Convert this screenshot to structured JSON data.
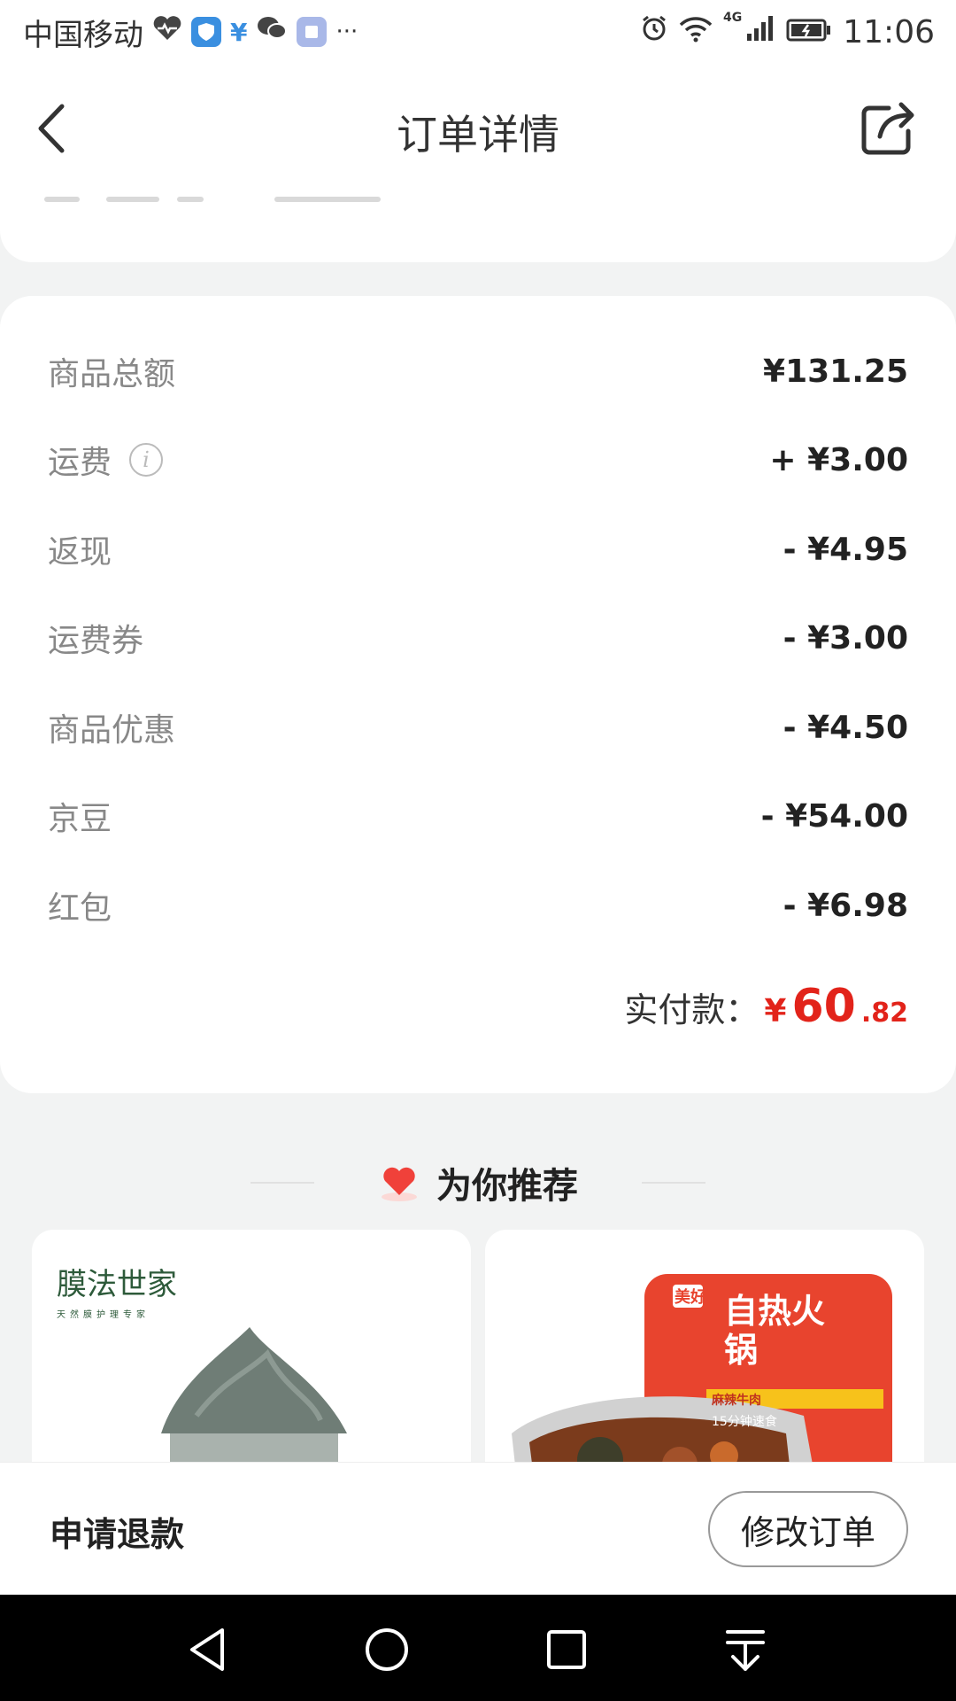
{
  "status_bar": {
    "carrier": "中国移动",
    "network": "4G",
    "time": "11:06",
    "overflow": "···"
  },
  "nav": {
    "title": "订单详情"
  },
  "price_rows": [
    {
      "label": "商品总额",
      "value": "¥131.25"
    },
    {
      "label": "运费",
      "value": "+ ¥3.00"
    },
    {
      "label": "返现",
      "value": "- ¥4.95"
    },
    {
      "label": "运费券",
      "value": "- ¥3.00"
    },
    {
      "label": "商品优惠",
      "value": "- ¥4.50"
    },
    {
      "label": "京豆",
      "value": "- ¥54.00"
    },
    {
      "label": "红包",
      "value": "- ¥6.98"
    }
  ],
  "total": {
    "label": "实付款：",
    "currency": "¥",
    "integer": "60",
    "decimal": ".82"
  },
  "recommend": {
    "title": "为你推荐"
  },
  "products": [
    {
      "brand": "膜法世家",
      "brand_sub": "天然膜护理专家"
    },
    {
      "brand": "美好",
      "name": "自热火锅",
      "tag": "麻辣牛肉",
      "note": "15分钟速食"
    }
  ],
  "bottom": {
    "refund": "申请退款",
    "modify": "修改订单"
  },
  "colors": {
    "accent_red": "#e2231a",
    "background": "#f2f3f3"
  }
}
